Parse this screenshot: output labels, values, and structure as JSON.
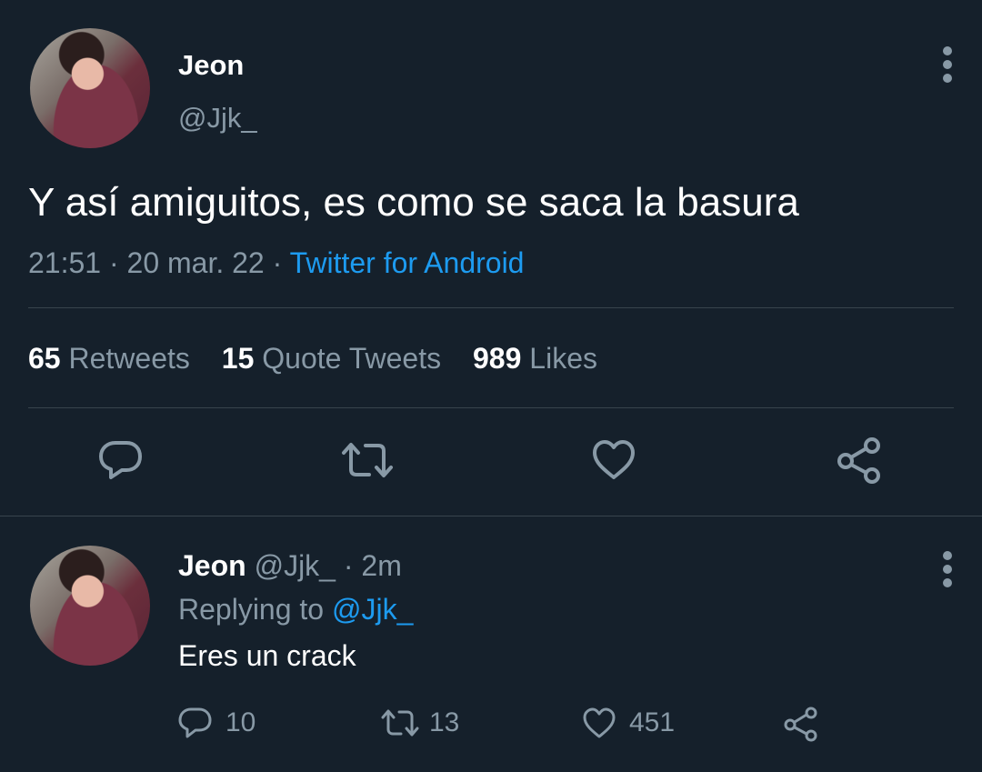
{
  "tweet": {
    "author_name": "Jeon",
    "author_handle": "@Jjk_",
    "text": "Y así amiguitos, es como se saca la basura",
    "time": "21:51",
    "sep1": "·",
    "date": "20 mar. 22",
    "sep2": "·",
    "source": "Twitter for Android",
    "stats": {
      "retweets_count": "65",
      "retweets_label": "Retweets",
      "quotes_count": "15",
      "quotes_label": "Quote Tweets",
      "likes_count": "989",
      "likes_label": "Likes"
    },
    "actions": [
      "reply-icon",
      "retweet-icon",
      "like-icon",
      "share-icon"
    ]
  },
  "reply": {
    "author_name": "Jeon",
    "author_handle": "@Jjk_",
    "sep": "·",
    "time": "2m",
    "replying_prefix": "Replying to",
    "replying_handle": "@Jjk_",
    "text": "Eres un crack",
    "counts": {
      "replies": "10",
      "retweets": "13",
      "likes": "451"
    }
  },
  "colors": {
    "background": "#15202b",
    "text": "#ffffff",
    "muted": "#8899a6",
    "accent": "#1d9bf0",
    "divider": "#38444d"
  }
}
